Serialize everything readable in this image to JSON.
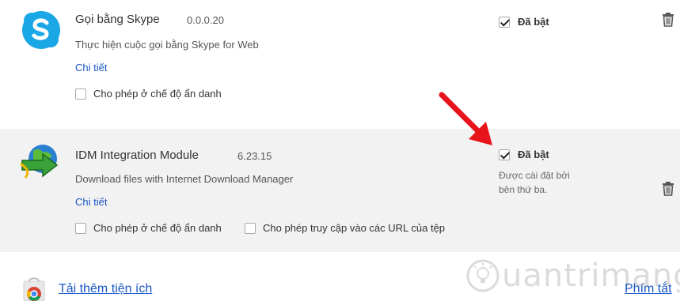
{
  "extensions": [
    {
      "name": "Gọi bằng Skype",
      "version": "0.0.0.20",
      "description": "Thực hiện cuộc gọi bằng Skype for Web",
      "details_label": "Chi tiết",
      "enabled_label": "Đã bật",
      "enabled": true,
      "options": [
        {
          "label": "Cho phép ở chế độ ẩn danh",
          "checked": false
        }
      ],
      "icon": "skype-icon"
    },
    {
      "name": "IDM Integration Module",
      "version": "6.23.15",
      "description": "Download files with Internet Download Manager",
      "details_label": "Chi tiết",
      "enabled_label": "Đã bật",
      "enabled": true,
      "installed_by_third_party": [
        "Được cài đặt bởi",
        "bên thứ ba."
      ],
      "options": [
        {
          "label": "Cho phép ở chế độ ẩn danh",
          "checked": false
        },
        {
          "label": "Cho phép truy cập vào các URL của tệp",
          "checked": false
        }
      ],
      "icon": "idm-icon"
    }
  ],
  "footer": {
    "get_more_label": "Tải thêm tiện ích",
    "shortcuts_label": "Phím tắt"
  },
  "watermark": {
    "text": "uantrimang"
  },
  "colors": {
    "link": "#1a57c6",
    "highlight_row": "#f2f2f2",
    "arrow": "#e8141b"
  }
}
